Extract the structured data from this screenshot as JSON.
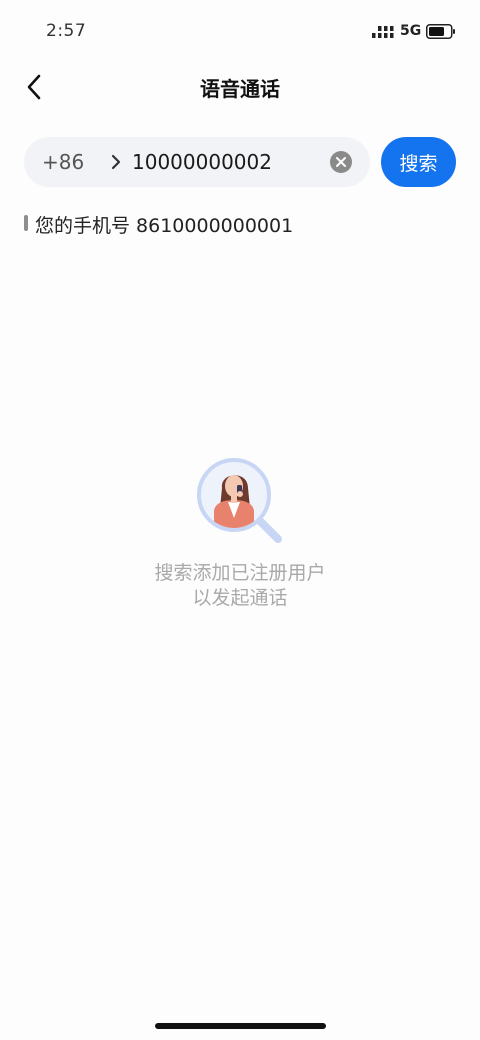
{
  "status_bar": {
    "time": "2:57",
    "network": "5G",
    "icons": [
      "signal-icon",
      "battery-icon"
    ]
  },
  "nav": {
    "title": "语音通话",
    "icons": [
      "back-icon"
    ]
  },
  "search": {
    "country_code": "+86",
    "input_value": "10000000002",
    "button_label": "搜索",
    "icons": [
      "chevron-right-icon",
      "clear-icon"
    ]
  },
  "my_number": {
    "label": "您的手机号 8610000000001"
  },
  "empty_state": {
    "line1": "搜索添加已注册用户",
    "line2": "以发起通话",
    "icons": [
      "search-person-illustration"
    ]
  },
  "colors": {
    "accent": "#1473ef",
    "search_bg": "#f2f3f7",
    "muted_text": "#a9a9a9"
  }
}
